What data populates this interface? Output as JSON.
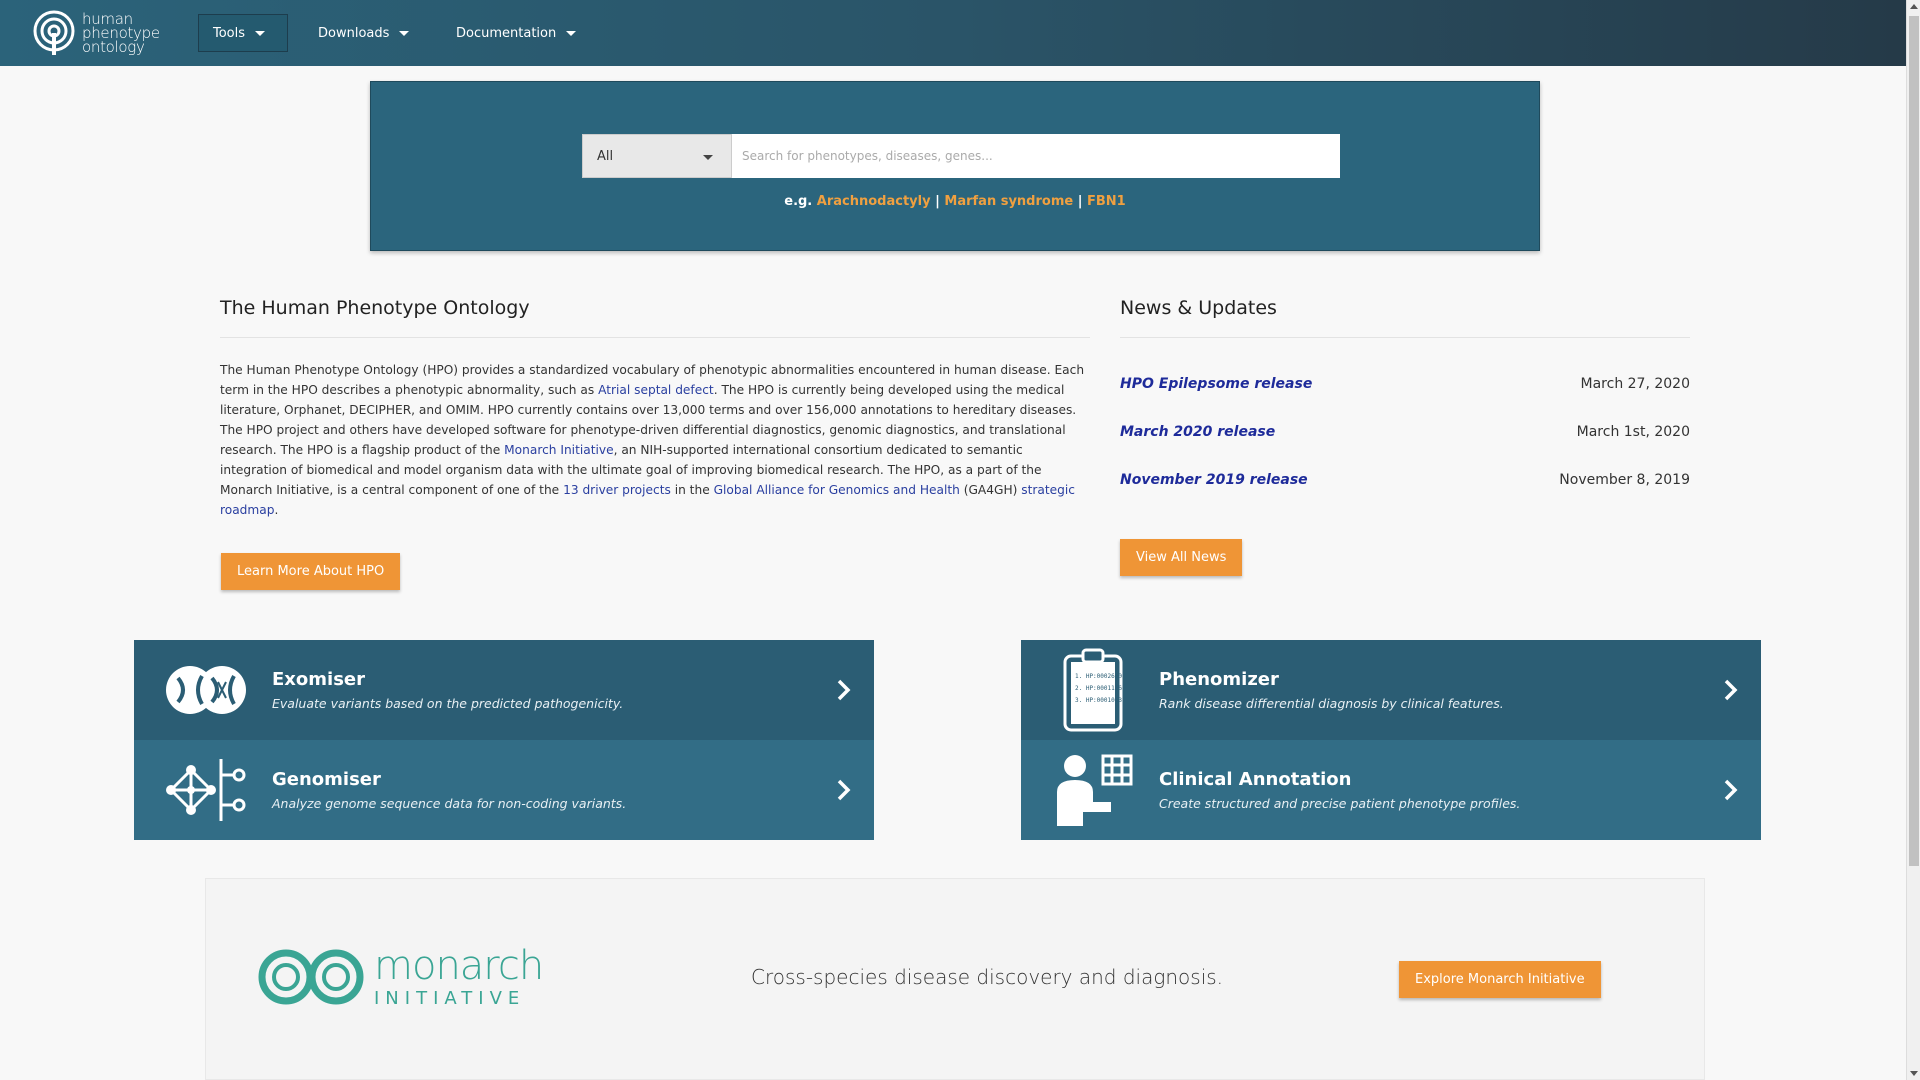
{
  "navbar": {
    "logo_lines": [
      "human",
      "phenotype",
      "ontology"
    ],
    "items": [
      {
        "label": "Tools",
        "active": true
      },
      {
        "label": "Downloads",
        "active": false
      },
      {
        "label": "Documentation",
        "active": false
      }
    ]
  },
  "search": {
    "category": "All",
    "placeholder": "Search for phenotypes, diseases, genes...",
    "examples_prefix": "e.g.",
    "examples": [
      "Arachnodactyly",
      "Marfan syndrome",
      "FBN1"
    ],
    "separator": "|"
  },
  "about": {
    "title": "The Human Phenotype Ontology",
    "p1": "The Human Phenotype Ontology (HPO) provides a standardized vocabulary of phenotypic abnormalities encountered in human disease. Each term in the HPO describes a phenotypic abnormality, such as ",
    "link1": "Atrial septal defect",
    "p2": ". The HPO is currently being developed using the medical literature, Orphanet, DECIPHER, and OMIM. HPO currently contains over 13,000 terms and over 156,000 annotations to hereditary diseases. The HPO project and others have developed software for phenotype-driven differential diagnostics, genomic diagnostics, and translational research. The HPO is a flagship product of the ",
    "link2": "Monarch Initiative",
    "p3": ", an NIH-supported international consortium dedicated to semantic integration of biomedical and model organism data with the ultimate goal of improving biomedical research. The HPO, as a part of the Monarch Initiative, is a central component of one of the ",
    "link3": "13 driver projects",
    "p4": " in the ",
    "link4": "Global Alliance for Genomics and Health",
    "p5": " (GA4GH) ",
    "link5": "strategic roadmap",
    "p6": ".",
    "button": "Learn More About HPO"
  },
  "news": {
    "title": "News & Updates",
    "items": [
      {
        "title": "HPO Epilepsome release",
        "date": "March 27, 2020"
      },
      {
        "title": "March 2020 release",
        "date": "March 1st, 2020"
      },
      {
        "title": "November 2019 release",
        "date": "November 8, 2019"
      }
    ],
    "button": "View All News"
  },
  "tiles": [
    {
      "title": "Exomiser",
      "desc": "Evaluate variants based on the predicted pathogenicity.",
      "icon": "dna-globe-icon"
    },
    {
      "title": "Genomiser",
      "desc": "Analyze genome sequence data for non-coding variants.",
      "icon": "network-icon"
    },
    {
      "title": "Phenomizer",
      "desc": "Rank disease differential diagnosis by clinical features.",
      "icon": "clipboard-icon",
      "clip_lines": [
        "1. HP:0002650",
        "2. HP:0001166",
        "3. HP:0001083"
      ]
    },
    {
      "title": "Clinical Annotation",
      "desc": "Create structured and precise patient phenotype profiles.",
      "icon": "patient-grid-icon"
    }
  ],
  "monarch": {
    "word1": "monarch",
    "word2": "INITIATIVE",
    "tagline": "Cross-species disease discovery and diagnosis.",
    "button": "Explore Monarch Initiative"
  },
  "colors": {
    "navbar": "#2b637a",
    "banner": "#2b657d",
    "accent_orange": "#ef9536",
    "link_blue": "#2a3fa0",
    "monarch_teal": "#3aa594"
  }
}
